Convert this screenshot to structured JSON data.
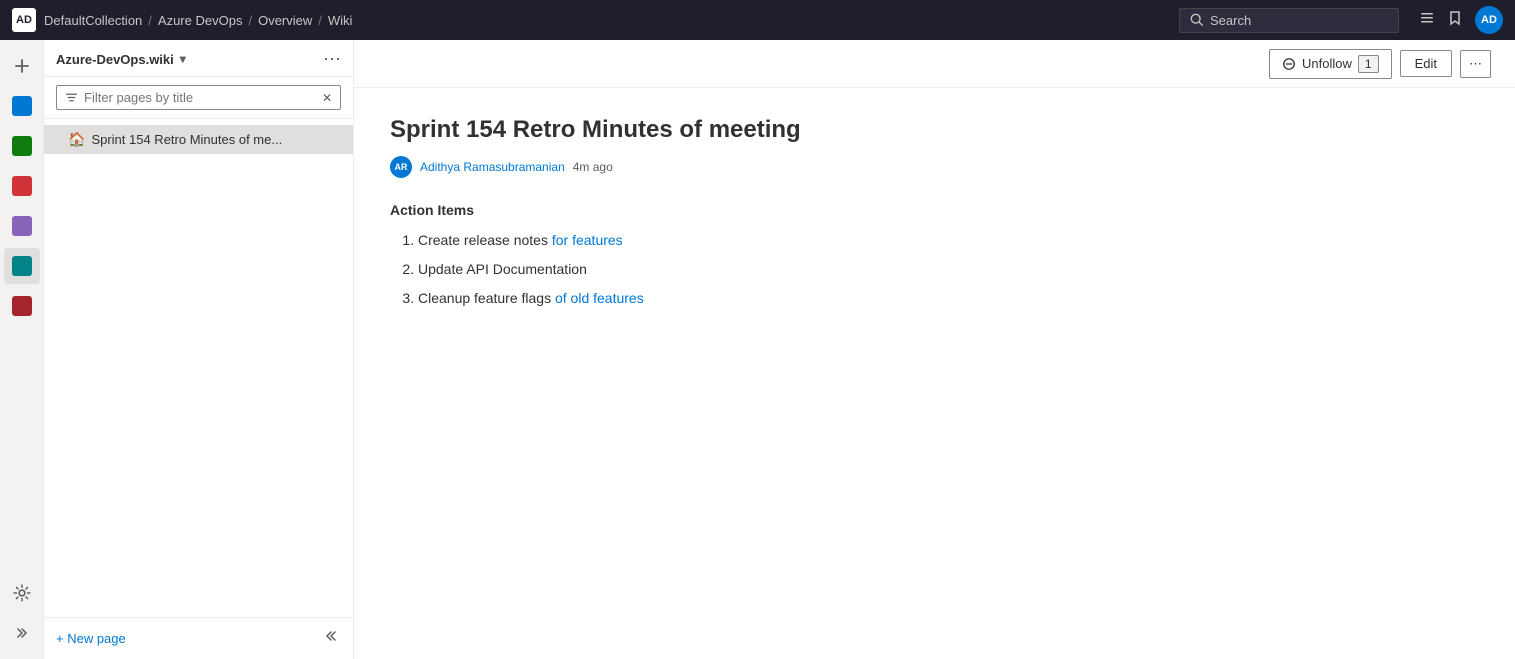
{
  "topnav": {
    "logo_text": "AD",
    "breadcrumbs": [
      {
        "label": "DefaultCollection"
      },
      {
        "label": "Azure DevOps"
      },
      {
        "label": "Overview"
      },
      {
        "label": "Wiki"
      }
    ],
    "search_placeholder": "Search",
    "icons": {
      "list": "☰",
      "bookmark": "🔖"
    },
    "avatar_text": "AD"
  },
  "sidebar": {
    "title": "Azure-DevOps.wiki",
    "filter_placeholder": "Filter pages by title",
    "tree_items": [
      {
        "label": "Sprint 154 Retro Minutes of me...",
        "icon": "🏠"
      }
    ],
    "new_page_label": "+ New page",
    "collapse_icon": "«"
  },
  "toolbar": {
    "unfollow_label": "Unfollow",
    "unfollow_count": "1",
    "edit_label": "Edit",
    "more_icon": "···"
  },
  "content": {
    "page_title": "Sprint 154 Retro Minutes of meeting",
    "meta": {
      "avatar_text": "AR",
      "author": "Adithya Ramasubramanian",
      "time_ago": "4m ago"
    },
    "section_heading": "Action Items",
    "action_items": [
      {
        "text_plain": "Create release notes ",
        "text_link": "for features",
        "text_after": ""
      },
      {
        "text_plain": "Update API Documentation",
        "text_link": "",
        "text_after": ""
      },
      {
        "text_plain": "Cleanup feature flags ",
        "text_link": "of old features",
        "text_after": ""
      }
    ]
  },
  "rail": {
    "items": [
      {
        "color": "ic-blue",
        "label": "boards"
      },
      {
        "color": "ic-green",
        "label": "pipelines"
      },
      {
        "color": "ic-red",
        "label": "artifacts"
      },
      {
        "color": "ic-purple",
        "label": "testplans"
      },
      {
        "color": "ic-teal",
        "label": "wiki-active"
      },
      {
        "color": "ic-darkred",
        "label": "extensions"
      }
    ],
    "settings_icon": "⚙"
  }
}
